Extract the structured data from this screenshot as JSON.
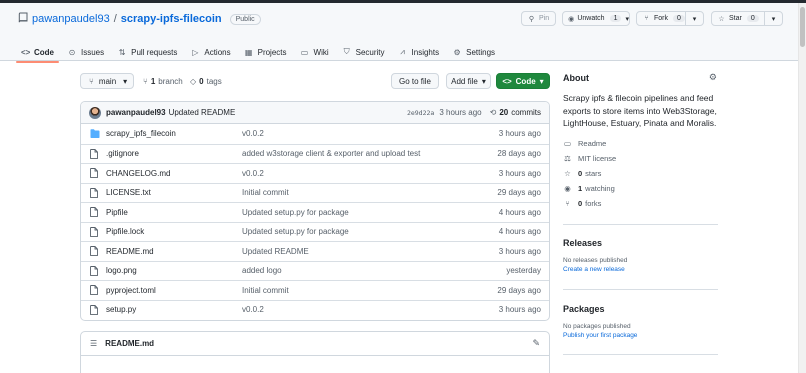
{
  "repo": {
    "owner": "pawanpaudel93",
    "name": "scrapy-ipfs-filecoin",
    "visibility": "Public"
  },
  "actions": {
    "pin": "Pin",
    "unwatch": "Unwatch",
    "watch_count": "1",
    "fork": "Fork",
    "fork_count": "0",
    "star": "Star",
    "star_count": "0"
  },
  "tabs": [
    {
      "label": "Code",
      "icon": "code-icon"
    },
    {
      "label": "Issues",
      "icon": "issue-icon"
    },
    {
      "label": "Pull requests",
      "icon": "pull-request-icon"
    },
    {
      "label": "Actions",
      "icon": "play-icon"
    },
    {
      "label": "Projects",
      "icon": "table-icon"
    },
    {
      "label": "Wiki",
      "icon": "book-icon"
    },
    {
      "label": "Security",
      "icon": "shield-icon"
    },
    {
      "label": "Insights",
      "icon": "graph-icon"
    },
    {
      "label": "Settings",
      "icon": "gear-icon"
    }
  ],
  "toolbar": {
    "branch": "main",
    "branch_count": "1",
    "branch_label": "branch",
    "tag_count": "0",
    "tag_label": "tags",
    "go_to_file": "Go to file",
    "add_file": "Add file",
    "code": "Code"
  },
  "latest_commit": {
    "author": "pawanpaudel93",
    "message": "Updated README",
    "sha": "2e9d22a",
    "ago": "3 hours ago",
    "commit_count": "20",
    "commits_label": "commits"
  },
  "files": [
    {
      "name": "scrapy_ipfs_filecoin",
      "type": "dir",
      "message": "v0.0.2",
      "age": "3 hours ago"
    },
    {
      "name": ".gitignore",
      "type": "file",
      "message": "added w3storage client & exporter and upload test",
      "age": "28 days ago"
    },
    {
      "name": "CHANGELOG.md",
      "type": "file",
      "message": "v0.0.2",
      "age": "3 hours ago"
    },
    {
      "name": "LICENSE.txt",
      "type": "file",
      "message": "Initial commit",
      "age": "29 days ago"
    },
    {
      "name": "Pipfile",
      "type": "file",
      "message": "Updated setup.py for package",
      "age": "4 hours ago"
    },
    {
      "name": "Pipfile.lock",
      "type": "file",
      "message": "Updated setup.py for package",
      "age": "4 hours ago"
    },
    {
      "name": "README.md",
      "type": "file",
      "message": "Updated README",
      "age": "3 hours ago"
    },
    {
      "name": "logo.png",
      "type": "file",
      "message": "added logo",
      "age": "yesterday"
    },
    {
      "name": "pyproject.toml",
      "type": "file",
      "message": "Initial commit",
      "age": "29 days ago"
    },
    {
      "name": "setup.py",
      "type": "file",
      "message": "v0.0.2",
      "age": "3 hours ago"
    }
  ],
  "readme": {
    "title": "README.md"
  },
  "about": {
    "title": "About",
    "description": "Scrapy ipfs & filecoin pipelines and feed exports to store items into Web3Storage, LightHouse, Estuary, Pinata and Moralis.",
    "readme": "Readme",
    "license": "MIT license",
    "stars_count": "0",
    "stars_label": "stars",
    "watching_count": "1",
    "watching_label": "watching",
    "forks_count": "0",
    "forks_label": "forks"
  },
  "releases": {
    "title": "Releases",
    "empty": "No releases published",
    "link": "Create a new release"
  },
  "packages": {
    "title": "Packages",
    "empty": "No packages published",
    "link": "Publish your first package"
  },
  "colors": {
    "accent": "#0969da",
    "green_button": "#1f883d",
    "active_tab_underline": "#fd8c73"
  }
}
